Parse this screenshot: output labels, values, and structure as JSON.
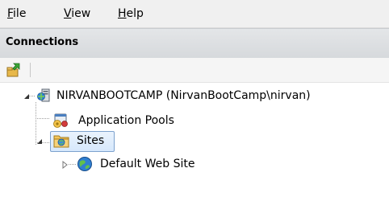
{
  "menu": {
    "file": {
      "first": "F",
      "rest": "ile"
    },
    "view": {
      "first": "V",
      "rest": "iew"
    },
    "help": {
      "first": "H",
      "rest": "elp"
    }
  },
  "panel": {
    "title": "Connections"
  },
  "toolbar": {
    "items": [
      "connect-icon"
    ]
  },
  "tree": {
    "server": {
      "label": "NIRVANBOOTCAMP (NirvanBootCamp\\nirvan)",
      "expanded": true
    },
    "app_pools": {
      "label": "Application Pools"
    },
    "sites": {
      "label": "Sites",
      "expanded": true,
      "selected": true
    },
    "default_site": {
      "label": "Default Web Site",
      "expanded": false
    }
  },
  "colors": {
    "selection_border": "#7da2ce",
    "selection_fill": "#d6e8fc"
  }
}
